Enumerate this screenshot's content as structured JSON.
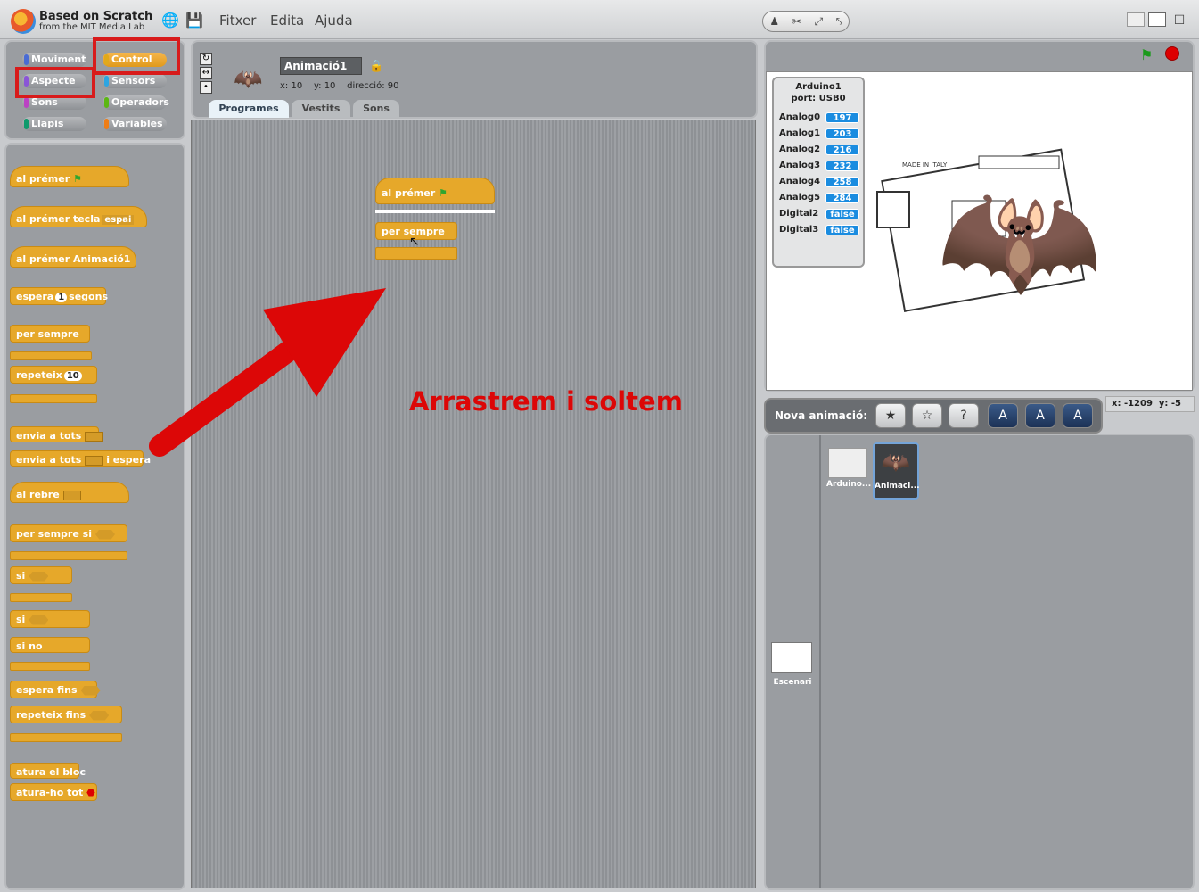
{
  "app": {
    "title_line1": "Based on Scratch",
    "title_line2": "from the MIT Media Lab"
  },
  "menu": {
    "file": "Fitxer",
    "edit": "Edita",
    "help": "Ajuda"
  },
  "categories": {
    "motion": "Moviment",
    "control": "Control",
    "looks": "Aspecte",
    "sensing": "Sensors",
    "sound": "Sons",
    "operators": "Operadors",
    "pen": "Llapis",
    "variables": "Variables"
  },
  "palette": {
    "when_flag": "al prémer",
    "when_key": "al prémer tecla",
    "when_key_value": "espai",
    "when_sprite": "al prémer  Animació1",
    "wait": "espera",
    "wait_value": "1",
    "wait_unit": "segons",
    "forever": "per sempre",
    "repeat": "repeteix",
    "repeat_value": "10",
    "broadcast": "envia a tots",
    "broadcast_wait": "envia a tots",
    "broadcast_wait_suffix": "i espera",
    "when_receive": "al rebre",
    "forever_if": "per sempre si",
    "if": "si",
    "if_else_if": "si",
    "else": "si no",
    "wait_until": "espera fins",
    "repeat_until": "repeteix fins",
    "stop_script": "atura el bloc",
    "stop_all": "atura-ho tot"
  },
  "sprite": {
    "name": "Animació1",
    "x_label": "x:",
    "x": "10",
    "y_label": "y:",
    "y": "10",
    "dir_label": "direcció:",
    "dir": "90"
  },
  "tabs": {
    "scripts": "Programes",
    "costumes": "Vestits",
    "sounds": "Sons"
  },
  "script": {
    "hat": "al prémer",
    "forever": "per sempre"
  },
  "annotation": "Arrastrem i soltem",
  "stage_vars": {
    "title": "Arduino1",
    "port": "port: USB0",
    "rows": [
      {
        "name": "Analog0",
        "value": "197"
      },
      {
        "name": "Analog1",
        "value": "203"
      },
      {
        "name": "Analog2",
        "value": "216"
      },
      {
        "name": "Analog3",
        "value": "232"
      },
      {
        "name": "Analog4",
        "value": "258"
      },
      {
        "name": "Analog5",
        "value": "284"
      },
      {
        "name": "Digital2",
        "value": "false"
      },
      {
        "name": "Digital3",
        "value": "false"
      }
    ]
  },
  "new_sprite": {
    "label": "Nova animació:"
  },
  "mouse": {
    "x_label": "x:",
    "x": "-1209",
    "y_label": "y:",
    "y": "-5"
  },
  "sprites": [
    {
      "name": "Arduino..."
    },
    {
      "name": "Animaci..."
    }
  ],
  "stage_item": {
    "name": "Escenari"
  }
}
